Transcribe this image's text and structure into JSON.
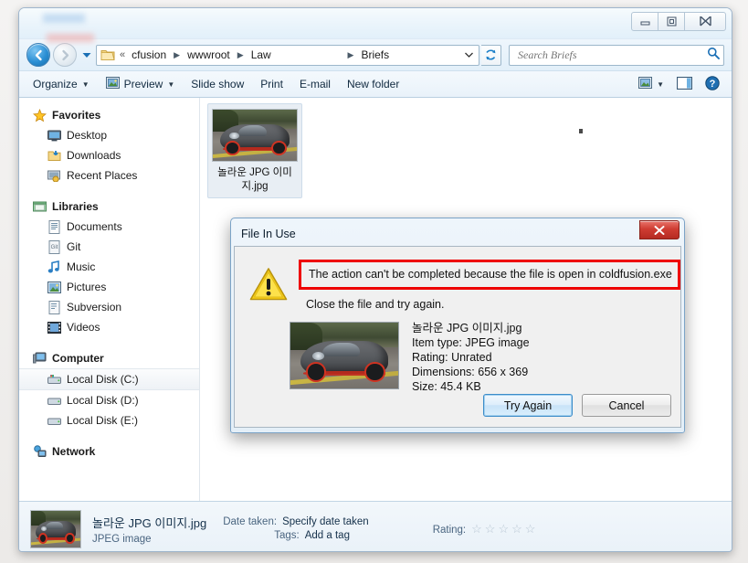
{
  "window": {
    "controls": {
      "minimize": "–",
      "maximize": "▣",
      "close": "✕"
    }
  },
  "address_bar": {
    "back_tooltip": "Back",
    "forward_tooltip": "Forward",
    "folder_icon": "folder-icon",
    "overflow": "«",
    "crumbs": [
      "cfusion",
      "wwwroot",
      "Law",
      "Briefs"
    ],
    "separator": "▸",
    "dropdown": "▾",
    "refresh": "↻"
  },
  "search": {
    "placeholder": "Search Briefs",
    "value": "",
    "icon": "search-icon"
  },
  "command_bar": {
    "organize": "Organize",
    "preview": "Preview",
    "slide_show": "Slide show",
    "print": "Print",
    "email": "E-mail",
    "new_folder": "New folder",
    "caret": "▾",
    "change_view_icon": "change-view-icon",
    "preview_pane_icon": "preview-pane-icon",
    "help_icon": "help-icon"
  },
  "nav_pane": {
    "groups": [
      {
        "label": "Favorites",
        "icon": "star-icon",
        "items": [
          {
            "label": "Desktop",
            "icon": "desktop-icon"
          },
          {
            "label": "Downloads",
            "icon": "downloads-icon"
          },
          {
            "label": "Recent Places",
            "icon": "recent-places-icon"
          }
        ]
      },
      {
        "label": "Libraries",
        "icon": "libraries-icon",
        "items": [
          {
            "label": "Documents",
            "icon": "documents-icon"
          },
          {
            "label": "Git",
            "icon": "git-icon"
          },
          {
            "label": "Music",
            "icon": "music-icon"
          },
          {
            "label": "Pictures",
            "icon": "pictures-icon"
          },
          {
            "label": "Subversion",
            "icon": "subversion-icon"
          },
          {
            "label": "Videos",
            "icon": "videos-icon"
          }
        ]
      },
      {
        "label": "Computer",
        "icon": "computer-icon",
        "items": [
          {
            "label": "Local Disk (C:)",
            "icon": "system-drive-icon",
            "selected": true
          },
          {
            "label": "Local Disk (D:)",
            "icon": "drive-icon"
          },
          {
            "label": "Local Disk (E:)",
            "icon": "drive-icon"
          }
        ]
      },
      {
        "label": "Network",
        "icon": "network-icon",
        "items": []
      }
    ]
  },
  "file_list": {
    "items": [
      {
        "name": "놀라운 JPG 이미지.jpg",
        "thumbnail": "sports-car-photo"
      }
    ]
  },
  "dialog": {
    "title": "File In Use",
    "close_label": "✕",
    "warning_icon": "warning-triangle-icon",
    "message": "The action can't be completed because the file is open in coldfusion.exe",
    "message_highlight_color": "#ee0000",
    "sub_message": "Close the file and try again.",
    "file": {
      "thumbnail": "sports-car-photo",
      "name": "놀라운 JPG 이미지.jpg",
      "item_type": "Item type: JPEG image",
      "rating": "Rating: Unrated",
      "dimensions": "Dimensions: 656 x 369",
      "size": "Size: 45.4 KB"
    },
    "buttons": {
      "try_again": "Try Again",
      "cancel": "Cancel"
    }
  },
  "details_pane": {
    "thumbnail": "sports-car-photo",
    "file_name": "놀라운 JPG 이미지.jpg",
    "file_type": "JPEG image",
    "date_taken_label": "Date taken:",
    "date_taken_value": "Specify date taken",
    "tags_label": "Tags:",
    "tags_value": "Add a tag",
    "rating_label": "Rating:",
    "rating_stars": [
      "☆",
      "☆",
      "☆",
      "☆",
      "☆"
    ],
    "rating_value": 0
  }
}
